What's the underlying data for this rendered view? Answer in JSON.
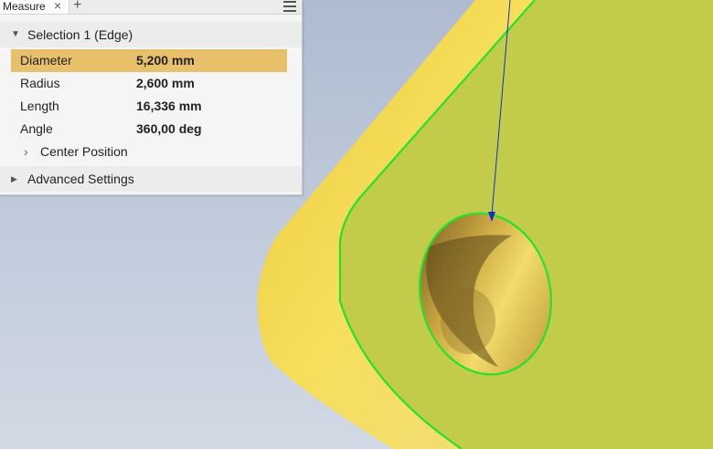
{
  "panel": {
    "tab_label": "Measure",
    "tab_close_icon": "×",
    "add_tab_icon": "+",
    "selection_title": "Selection 1 (Edge)",
    "rows": [
      {
        "label": "Diameter",
        "value": "5,200 mm"
      },
      {
        "label": "Radius",
        "value": "2,600 mm"
      },
      {
        "label": "Length",
        "value": "16,336 mm"
      },
      {
        "label": "Angle",
        "value": "360,00 deg"
      }
    ],
    "center_position_label": "Center Position",
    "advanced_settings_label": "Advanced Settings"
  },
  "colors": {
    "part_top": "#c3cc4a",
    "part_side": "#f1d64a",
    "edge_highlight": "#22e22a",
    "leader_line": "#1030c8",
    "selected_row": "#e8bf6b"
  }
}
